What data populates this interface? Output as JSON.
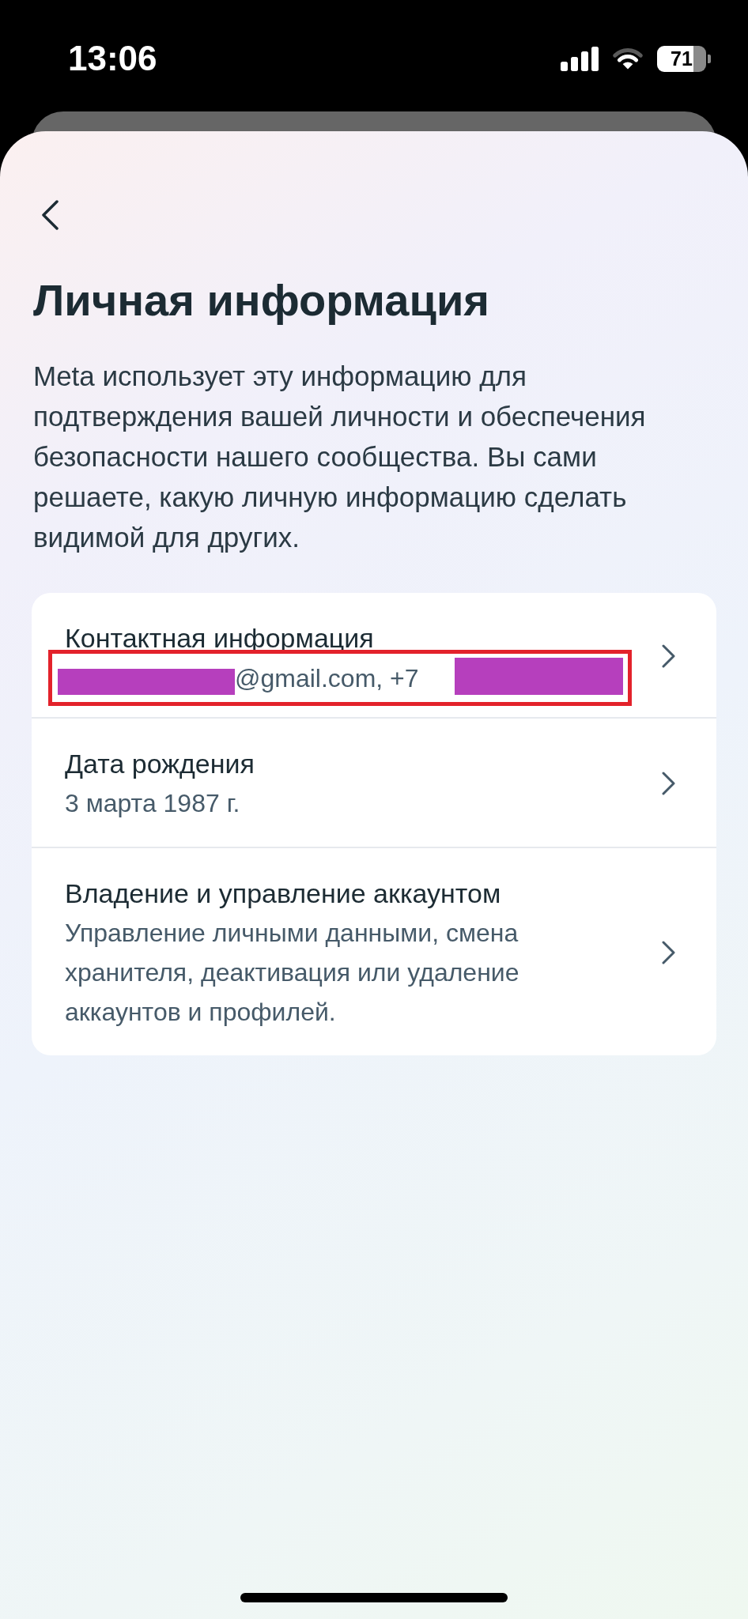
{
  "status_bar": {
    "time": "13:06",
    "battery": "71"
  },
  "header": {
    "title": "Личная информация",
    "description": "Meta использует эту информацию для подтверждения вашей личности и обеспечения безопасности нашего сообщества. Вы сами решаете, какую личную информацию сделать видимой для других."
  },
  "items": [
    {
      "kind": "redacted",
      "title": "Контактная информация",
      "subtitle": "@gmail.com, +7"
    },
    {
      "kind": "plain",
      "title": "Дата рождения",
      "subtitle": "3 марта 1987 г."
    },
    {
      "kind": "plain",
      "title": "Владение и управление аккаунтом",
      "subtitle": "Управление личными данными, смена хранителя, деактивация или удаление аккаунтов и профилей."
    }
  ]
}
